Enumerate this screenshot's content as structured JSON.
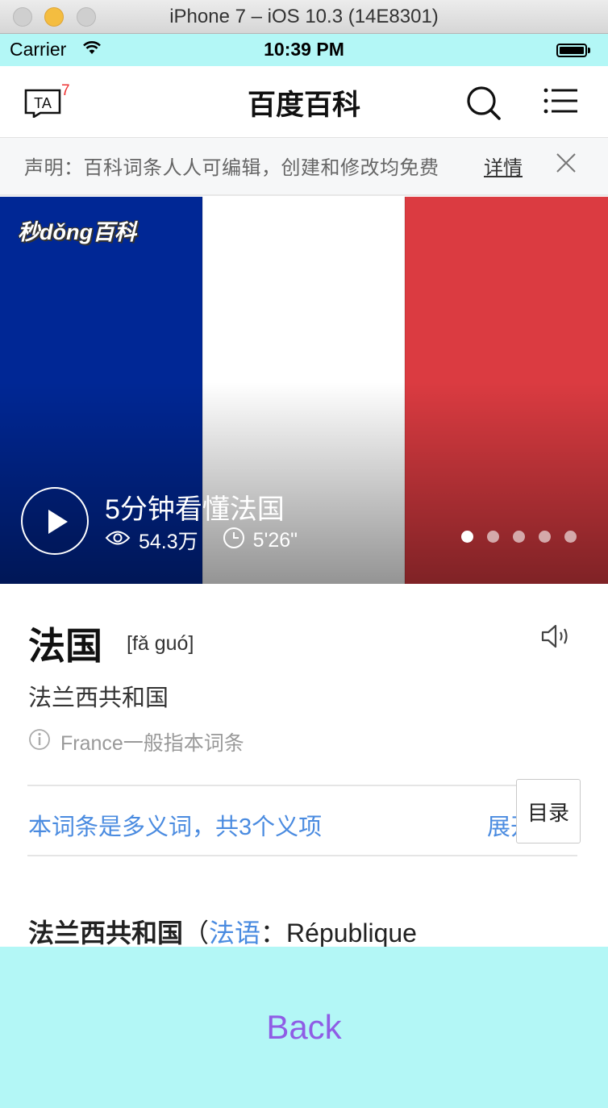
{
  "window": {
    "title": "iPhone 7 – iOS 10.3 (14E8301)"
  },
  "status_bar": {
    "carrier": "Carrier",
    "time": "10:39 PM",
    "battery_level": 1.0
  },
  "header": {
    "logo_text": "TA",
    "badge": "7",
    "title": "百度百科",
    "search_icon": "search-icon",
    "menu_icon": "menu-icon"
  },
  "notice": {
    "text": "声明：百科词条人人可编辑，创建和修改均免费",
    "link": "详情",
    "close_icon": "close-icon"
  },
  "video": {
    "logo": "秒dǒng百科",
    "title": "5分钟看懂法国",
    "views": "54.3万",
    "duration": "5'26\"",
    "slide_count": 5,
    "active_slide": 1,
    "colors": {
      "blue": "#002795",
      "white": "#ffffff",
      "red": "#db3b41"
    }
  },
  "entry": {
    "title": "法国",
    "pinyin": "[fǎ guó]",
    "subtitle": "法兰西共和国",
    "note": "France一般指本词条",
    "polysemy": "本词条是多义词，共3个义项",
    "expand": "展开",
    "toc": "目录",
    "body_strong": "法兰西共和国",
    "body_paren": "（",
    "body_link": "法语",
    "body_rest": "：République"
  },
  "bottom": {
    "back": "Back"
  },
  "accent_colors": {
    "link": "#4a8be0",
    "status_bar": "#b3f7f6",
    "back": "#8f5de5"
  }
}
